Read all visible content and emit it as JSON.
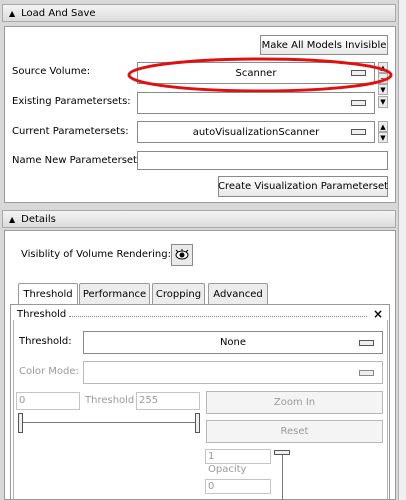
{
  "load_and_save": {
    "title": "Load And Save",
    "make_invisible_label": "Make All Models Invisible",
    "source_volume_label": "Source Volume:",
    "source_volume_value": "Scanner",
    "existing_label": "Existing Parametersets:",
    "existing_value": "",
    "current_label": "Current Parametersets:",
    "current_value": "autoVisualizationScanner",
    "name_new_label": "Name New Parameterset:",
    "name_new_value": "",
    "create_label": "Create Visualization Parameterset"
  },
  "details": {
    "title": "Details",
    "visibility_label": "Visiblity of Volume Rendering:",
    "tabs": [
      {
        "label": "Threshold"
      },
      {
        "label": "Performance"
      },
      {
        "label": "Cropping"
      },
      {
        "label": "Advanced"
      }
    ],
    "threshold_group": {
      "title": "Threshold",
      "close": "×",
      "threshold_label": "Threshold:",
      "threshold_value": "None",
      "color_mode_label": "Color Mode:",
      "color_mode_value": "",
      "min_value": "0",
      "middle_label": "Threshold",
      "max_value": "255",
      "zoom_in_label": "Zoom In",
      "reset_label": "Reset",
      "opacity_top_value": "1",
      "opacity_label": "Opacity",
      "opacity_bottom_value": "0"
    }
  },
  "colors": {
    "highlight_ellipse": "#e01010",
    "panel_bg": "#ffffff",
    "window_bg": "#d8d8d8"
  }
}
